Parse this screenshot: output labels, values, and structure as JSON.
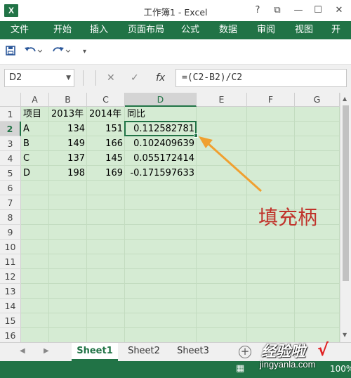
{
  "app": {
    "logo": "X",
    "title": "工作簿1 - Excel"
  },
  "window_controls": [
    "?",
    "⧉",
    "—",
    "☐",
    "✕"
  ],
  "ribbon": {
    "file_tab": "文件",
    "tabs": [
      "开始",
      "插入",
      "页面布局",
      "公式",
      "数据",
      "审阅",
      "视图",
      "开"
    ]
  },
  "quick_access": {
    "save_icon": "floppy-disk-icon",
    "undo_icon": "undo-icon",
    "redo_icon": "redo-icon"
  },
  "formula_bar": {
    "name_box": "D2",
    "cancel": "✕",
    "enter": "✓",
    "fx": "fx",
    "formula": "=(C2-B2)/C2"
  },
  "columns": [
    "A",
    "B",
    "C",
    "D",
    "E",
    "F",
    "G"
  ],
  "selected_column": "D",
  "rows": [
    "1",
    "2",
    "3",
    "4",
    "5",
    "6",
    "7",
    "8",
    "9",
    "10",
    "11",
    "12",
    "13",
    "14",
    "15",
    "16"
  ],
  "selected_row": "2",
  "cells": {
    "r1": [
      "项目",
      "2013年",
      "2014年",
      "同比"
    ],
    "r2": [
      "A",
      "134",
      "151",
      "0.112582781"
    ],
    "r3": [
      "B",
      "149",
      "166",
      "0.102409639"
    ],
    "r4": [
      "C",
      "137",
      "145",
      "0.055172414"
    ],
    "r5": [
      "D",
      "198",
      "169",
      "-0.171597633"
    ]
  },
  "sheets": [
    "Sheet1",
    "Sheet2",
    "Sheet3"
  ],
  "active_sheet": "Sheet1",
  "annotation": {
    "label": "填充柄",
    "color": "#c0332b",
    "arrow_color": "#f0a030"
  },
  "watermark": {
    "text": "经验啦",
    "check": "√",
    "url": "jingyanla.com"
  },
  "status": {
    "ready": "",
    "zoom": "100%"
  },
  "colors": {
    "accent": "#217346",
    "grid_bg": "#d5ebd3"
  }
}
